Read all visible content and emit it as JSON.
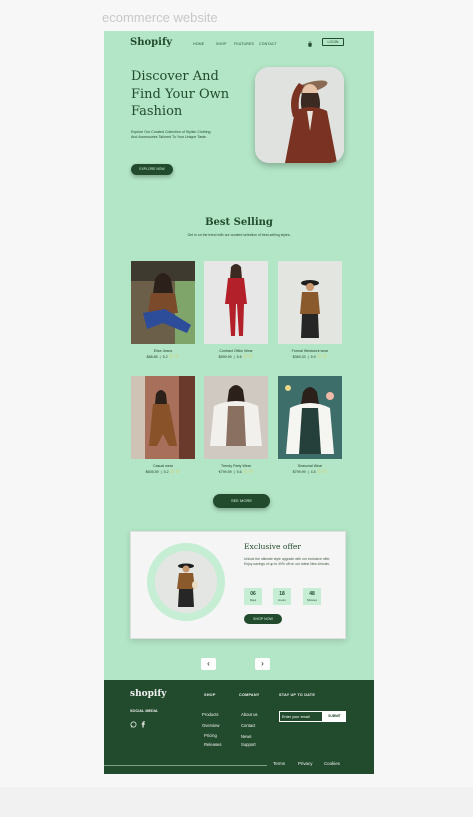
{
  "canvas_label": "ecommerce website",
  "nav": {
    "logo": "Shopify",
    "links": [
      "HOME",
      "SHOP",
      "FEATURES",
      "CONTACT"
    ],
    "login": "LOGIN"
  },
  "hero": {
    "title": "Discover And Find Your Own Fashion",
    "description": "Explore Our Curated Collection of Stylish Clothing And Accessories Tailored To Your Unique Taste.",
    "cta": "EXPLORE NOW"
  },
  "best_selling": {
    "title": "Best Selling",
    "subtitle": "Get in on the trend with our curated selection of best-selling styles.",
    "products": [
      {
        "name": "Elise Jeans",
        "price": "$88.85",
        "rating": "5.2"
      },
      {
        "name": "Contract Office Wear",
        "price": "$599.99",
        "rating": "5.6"
      },
      {
        "name": "Formal Westwork wear",
        "price": "$369.33",
        "rating": "5.9"
      },
      {
        "name": "Casual wear",
        "price": "$605.59",
        "rating": "5.2"
      },
      {
        "name": "Trendy Party Wear",
        "price": "€799.59",
        "rating": "5.6"
      },
      {
        "name": "Seasonal Wear",
        "price": "$799.99",
        "rating": "4.5"
      }
    ],
    "see_more": "SEE MORE"
  },
  "offer": {
    "title": "Exclusive offer",
    "description": "Unlock the ultimate style upgrade with our exclusive offer. Enjoy savings of up to 40% off on our latest New Arrivals.",
    "countdown": [
      {
        "value": "06",
        "unit": "Days"
      },
      {
        "value": "18",
        "unit": "Hours"
      },
      {
        "value": "48",
        "unit": "Minutes"
      }
    ],
    "cta": "SHOP NOW"
  },
  "pagination": {
    "prev": "‹",
    "next": "›"
  },
  "footer": {
    "logo": "shopify",
    "social_label": "SOCIAL MEDIA",
    "shop_heading": "SHOP",
    "shop_links": [
      "Products",
      "Overview",
      "Pricing",
      "Releases"
    ],
    "company_heading": "COMPANY",
    "company_links": [
      "About us",
      "Contact",
      "News",
      "Support"
    ],
    "stay_heading": "STAY UP TO DATE",
    "email_placeholder": "Enter your email",
    "submit": "SUBMIT",
    "bottom_links": [
      "Terms",
      "Privacy",
      "Cookies"
    ]
  },
  "colors": {
    "page_bg": "#b3e6c6",
    "primary": "#224b2d",
    "star": "#e6c747"
  }
}
